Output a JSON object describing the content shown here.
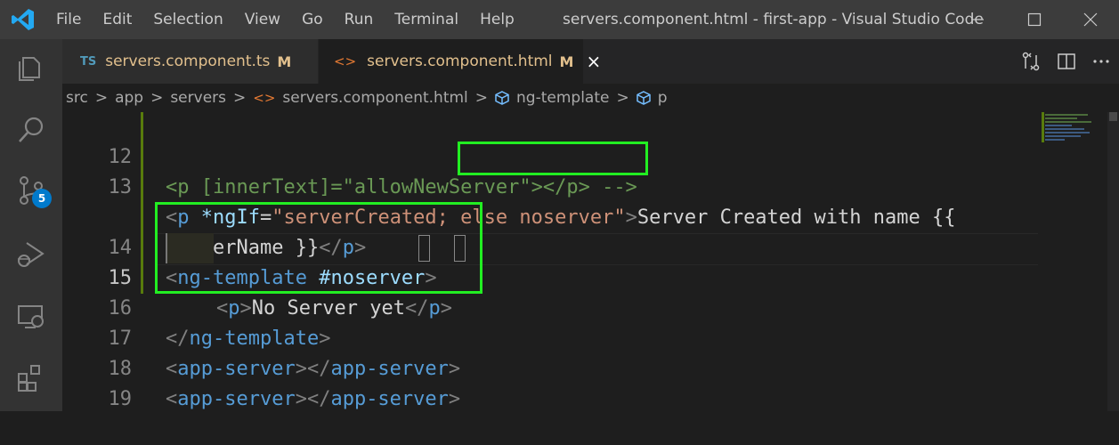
{
  "window": {
    "title": "servers.component.html - first-app - Visual Studio Code",
    "menu": [
      "File",
      "Edit",
      "Selection",
      "View",
      "Go",
      "Run",
      "Terminal",
      "Help"
    ]
  },
  "activity_bar": {
    "source_control_badge": "5",
    "items": [
      "explorer-icon",
      "search-icon",
      "source-control-icon",
      "run-debug-icon",
      "remote-explorer-icon",
      "extensions-icon"
    ]
  },
  "tabs": [
    {
      "icon": "TS",
      "label": "servers.component.ts",
      "modified": "M"
    },
    {
      "icon": "<>",
      "label": "servers.component.html",
      "modified": "M",
      "close": "×"
    }
  ],
  "breadcrumb": {
    "src": "src",
    "app": "app",
    "servers": "servers",
    "file": "servers.component.html",
    "ng_template": "ng-template",
    "p": "p",
    "separator": ">"
  },
  "code": {
    "line_numbers": [
      "12",
      "13",
      "",
      "14",
      "15",
      "16",
      "17",
      "18",
      "19"
    ],
    "l12": {
      "a": "<p [innerText]=\"allowNewServer\"></p> -->"
    },
    "l13": {
      "open": "<",
      "tag": "p",
      "sp": " ",
      "attr": "*ngIf",
      "eq": "=",
      "q1": "\"",
      "val1": "serverCreated",
      "val2": "; else noserver",
      "q2": "\"",
      "close": ">",
      "text": "Server Created with name {{"
    },
    "l13b": {
      "text": "serverName }}",
      "open": "</",
      "tag": "p",
      "close": ">"
    },
    "l14": {
      "open": "<",
      "tag": "ng-template",
      "sp": " ",
      "attr": "#noserver",
      "close": ">"
    },
    "l15": {
      "open": "<",
      "tag": "p",
      "close": ">",
      "text": "No Server yet",
      "open2": "</",
      "tag2": "p",
      "close2": ">"
    },
    "l16": {
      "open": "</",
      "tag": "ng-template",
      "close": ">"
    },
    "l17": {
      "open": "<",
      "tag": "app-server",
      "mid": "></",
      "tag2": "app-server",
      "close": ">"
    },
    "l18": {
      "open": "<",
      "tag": "app-server",
      "mid": "></",
      "tag2": "app-server",
      "close": ">"
    }
  },
  "colors": {
    "highlight_box": "#22ee22",
    "comment": "#6a9955",
    "tag": "#569cd6",
    "attribute": "#9cdcfe",
    "string": "#ce9178",
    "modified_gutter": "#587c0c"
  }
}
